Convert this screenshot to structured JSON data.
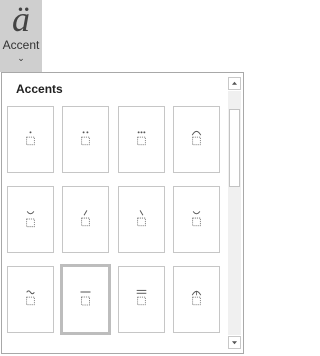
{
  "ribbon": {
    "glyph": "ä",
    "label": "Accent",
    "caret": "⌄"
  },
  "gallery": {
    "title": "Accents",
    "selected_index": 9,
    "items": [
      {
        "icon": "dot-accent-icon"
      },
      {
        "icon": "double-dot-accent-icon"
      },
      {
        "icon": "triple-dot-accent-icon"
      },
      {
        "icon": "hat-accent-icon"
      },
      {
        "icon": "check-accent-icon"
      },
      {
        "icon": "acute-accent-icon"
      },
      {
        "icon": "grave-accent-icon"
      },
      {
        "icon": "breve-accent-icon"
      },
      {
        "icon": "tilde-accent-icon"
      },
      {
        "icon": "bar-accent-icon"
      },
      {
        "icon": "double-bar-accent-icon"
      },
      {
        "icon": "arrow-hat-accent-icon"
      }
    ]
  },
  "scrollbar": {
    "up_icon": "scroll-up-arrow-icon",
    "down_icon": "scroll-down-arrow-icon"
  }
}
